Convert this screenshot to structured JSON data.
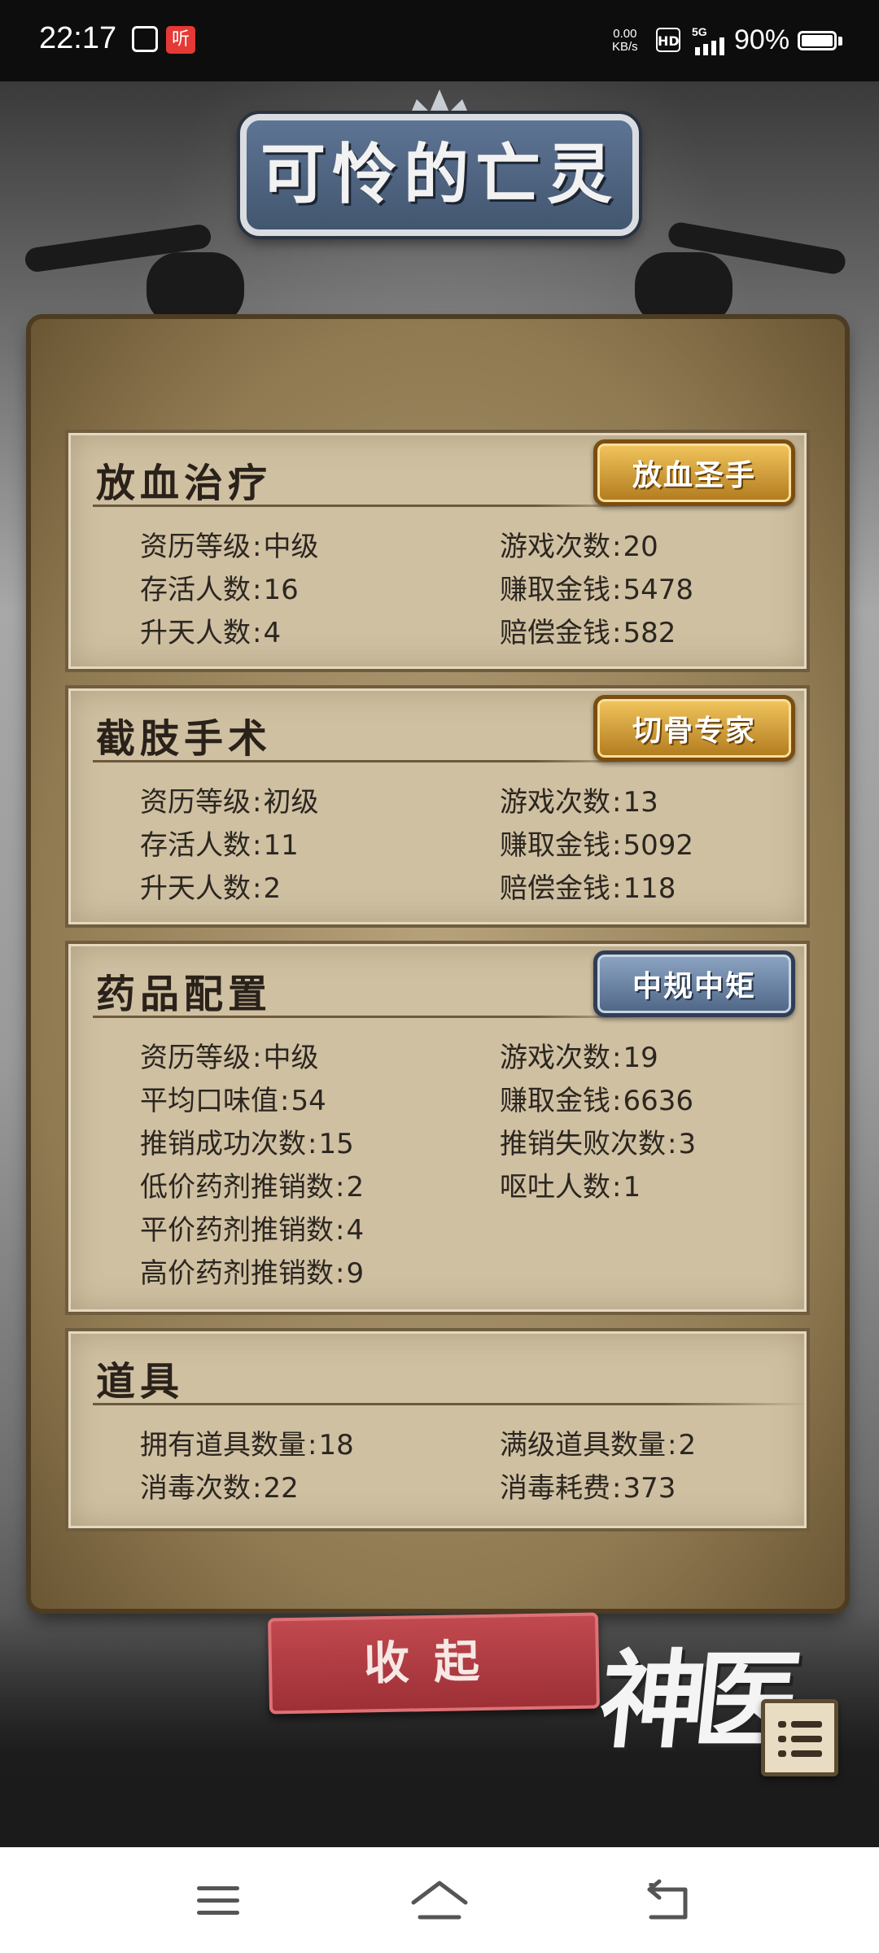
{
  "status_bar": {
    "time": "22:17",
    "app_badge": "听",
    "net_speed_value": "0.00",
    "net_speed_unit": "KB/s",
    "hd": "HD",
    "network": "5G",
    "battery": "90%"
  },
  "title": "可怜的亡灵",
  "sections": [
    {
      "title": "放血治疗",
      "badge": "放血圣手",
      "badge_color": "#c8962e",
      "rows": [
        {
          "left": {
            "label": "资历等级",
            "value": "中级"
          },
          "right": {
            "label": "游戏次数",
            "value": "20"
          }
        },
        {
          "left": {
            "label": "存活人数",
            "value": "16"
          },
          "right": {
            "label": "赚取金钱",
            "value": "5478"
          }
        },
        {
          "left": {
            "label": "升天人数",
            "value": "4"
          },
          "right": {
            "label": "赔偿金钱",
            "value": "582"
          }
        }
      ]
    },
    {
      "title": "截肢手术",
      "badge": "切骨专家",
      "badge_color": "#c8962e",
      "rows": [
        {
          "left": {
            "label": "资历等级",
            "value": "初级"
          },
          "right": {
            "label": "游戏次数",
            "value": "13"
          }
        },
        {
          "left": {
            "label": "存活人数",
            "value": "11"
          },
          "right": {
            "label": "赚取金钱",
            "value": "5092"
          }
        },
        {
          "left": {
            "label": "升天人数",
            "value": "2"
          },
          "right": {
            "label": "赔偿金钱",
            "value": "118"
          }
        }
      ]
    },
    {
      "title": "药品配置",
      "badge": "中规中矩",
      "badge_color": "#5d7497",
      "rows": [
        {
          "left": {
            "label": "资历等级",
            "value": "中级"
          },
          "right": {
            "label": "游戏次数",
            "value": "19"
          }
        },
        {
          "left": {
            "label": "平均口味值",
            "value": "54"
          },
          "right": {
            "label": "赚取金钱",
            "value": "6636"
          }
        },
        {
          "left": {
            "label": "推销成功次数",
            "value": "15"
          },
          "right": {
            "label": "推销失败次数",
            "value": "3"
          }
        },
        {
          "left": {
            "label": "低价药剂推销数",
            "value": "2"
          },
          "right": {
            "label": "呕吐人数",
            "value": "1"
          }
        },
        {
          "left": {
            "label": "平价药剂推销数",
            "value": "4"
          }
        },
        {
          "left": {
            "label": "高价药剂推销数",
            "value": "9"
          }
        }
      ]
    },
    {
      "title": "道具",
      "rows": [
        {
          "left": {
            "label": "拥有道具数量",
            "value": "18"
          },
          "right": {
            "label": "满级道具数量",
            "value": "2"
          }
        },
        {
          "left": {
            "label": "消毒次数",
            "value": "22"
          },
          "right": {
            "label": "消毒耗费",
            "value": "373"
          }
        }
      ]
    }
  ],
  "collapse_button": "收起",
  "logo": "神医",
  "icons": {
    "menu": "list-menu-icon",
    "nav_menu": "hamburger-icon",
    "nav_home": "home-icon",
    "nav_back": "back-icon"
  }
}
